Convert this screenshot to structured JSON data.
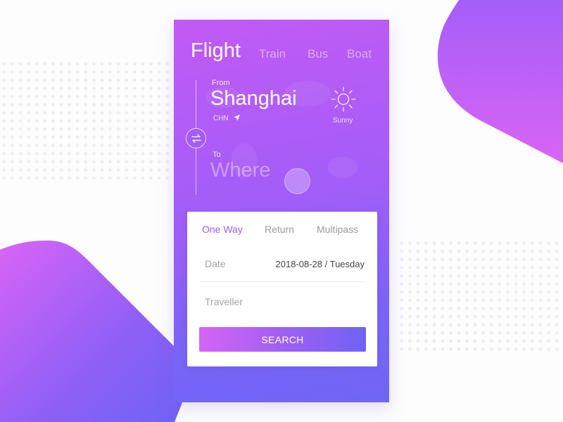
{
  "colors": {
    "accent": "#9f5bf0",
    "gradient_start": "#d564f5",
    "gradient_end": "#6e63f5",
    "background": "#fdfdfe"
  },
  "transport_tabs": [
    {
      "label": "Flight",
      "active": true
    },
    {
      "label": "Train",
      "active": false
    },
    {
      "label": "Bus",
      "active": false
    },
    {
      "label": "Boat",
      "active": false
    }
  ],
  "route": {
    "from": {
      "label": "From",
      "city": "Shanghai",
      "country_code": "CHN",
      "location_icon": "navigation-arrow-icon"
    },
    "swap_icon": "swap-arrows-icon",
    "to": {
      "label": "To",
      "placeholder": "Where"
    }
  },
  "weather": {
    "icon": "sun-icon",
    "label": "Sunny"
  },
  "trip_types": [
    {
      "label": "One Way",
      "active": true
    },
    {
      "label": "Return",
      "active": false
    },
    {
      "label": "Multipass",
      "active": false
    }
  ],
  "form": {
    "date": {
      "label": "Date",
      "value": "2018-08-28 / Tuesday"
    },
    "traveller": {
      "label": "Traveller",
      "value": ""
    }
  },
  "search_button": {
    "label": "SEARCH"
  }
}
